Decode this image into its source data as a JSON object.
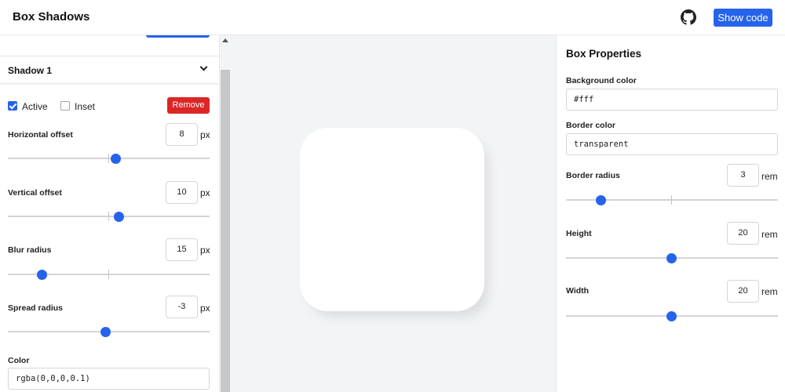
{
  "header": {
    "title": "Box Shadows",
    "github_icon": "github-icon",
    "show_code_label": "Show code"
  },
  "shadow_panel": {
    "title": "Shadow 1",
    "active_label": "Active",
    "active_checked": true,
    "inset_label": "Inset",
    "inset_checked": false,
    "remove_label": "Remove",
    "horizontal_offset": {
      "label": "Horizontal offset",
      "value": "8",
      "unit": "px",
      "slider_fraction": 0.53
    },
    "vertical_offset": {
      "label": "Vertical offset",
      "value": "10",
      "unit": "px",
      "slider_fraction": 0.55
    },
    "blur_radius": {
      "label": "Blur radius",
      "value": "15",
      "unit": "px",
      "slider_fraction": 0.17
    },
    "spread_radius": {
      "label": "Spread radius",
      "value": "-3",
      "unit": "px",
      "slider_fraction": 0.49
    },
    "color": {
      "label": "Color",
      "value": "rgba(0,0,0,0.1)"
    }
  },
  "box_properties": {
    "title": "Box Properties",
    "background_color": {
      "label": "Background color",
      "value": "#fff"
    },
    "border_color": {
      "label": "Border color",
      "value": "transparent"
    },
    "border_radius": {
      "label": "Border radius",
      "value": "3",
      "unit": "rem",
      "slider_fraction": 0.16
    },
    "height": {
      "label": "Height",
      "value": "20",
      "unit": "rem",
      "slider_fraction": 0.5
    },
    "width": {
      "label": "Width",
      "value": "20",
      "unit": "rem",
      "slider_fraction": 0.5
    }
  },
  "colors": {
    "accent": "#2563eb",
    "danger": "#dc2626",
    "preview_background": "#f3f4f6"
  }
}
